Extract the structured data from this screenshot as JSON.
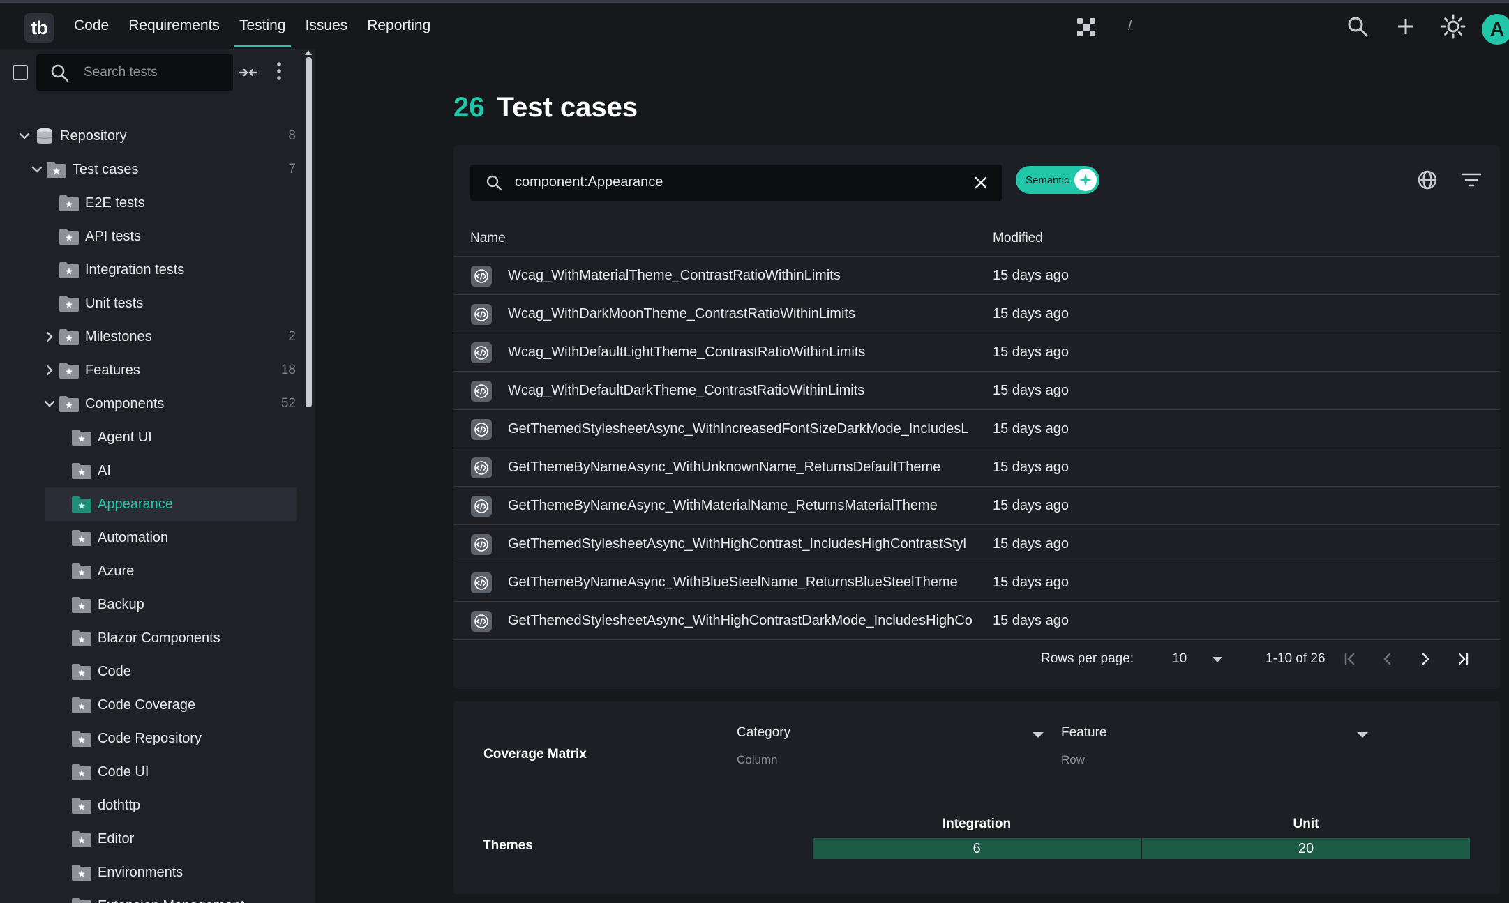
{
  "app": {
    "logo_text": "tb",
    "nav": [
      "Code",
      "Requirements",
      "Testing",
      "Issues",
      "Reporting"
    ],
    "active_nav": "Testing",
    "breadcrumb_separator": "/",
    "avatar_initial": "A",
    "accent_color": "#22c7a9"
  },
  "sidebar": {
    "search_placeholder": "Search tests",
    "tree": [
      {
        "label": "Repository",
        "count": "8",
        "chevron": "down",
        "icon": "database-icon",
        "level": 0
      },
      {
        "label": "Test cases",
        "count": "7",
        "chevron": "down",
        "icon": "folder-icon",
        "level": 1
      },
      {
        "label": "E2E tests",
        "count": "",
        "chevron": "",
        "icon": "folder-icon",
        "level": 2
      },
      {
        "label": "API tests",
        "count": "",
        "chevron": "",
        "icon": "folder-icon",
        "level": 2
      },
      {
        "label": "Integration tests",
        "count": "",
        "chevron": "",
        "icon": "folder-icon",
        "level": 2
      },
      {
        "label": "Unit tests",
        "count": "",
        "chevron": "",
        "icon": "folder-icon",
        "level": 2
      },
      {
        "label": "Milestones",
        "count": "2",
        "chevron": "right",
        "icon": "folder-icon",
        "level": 2
      },
      {
        "label": "Features",
        "count": "18",
        "chevron": "right",
        "icon": "folder-icon",
        "level": 2
      },
      {
        "label": "Components",
        "count": "52",
        "chevron": "down",
        "icon": "folder-icon",
        "level": 2
      },
      {
        "label": "Agent UI",
        "count": "",
        "chevron": "",
        "icon": "folder-icon",
        "level": 3
      },
      {
        "label": "AI",
        "count": "",
        "chevron": "",
        "icon": "folder-icon",
        "level": 3
      },
      {
        "label": "Appearance",
        "count": "",
        "chevron": "",
        "icon": "folder-icon",
        "level": 3,
        "selected": true
      },
      {
        "label": "Automation",
        "count": "",
        "chevron": "",
        "icon": "folder-icon",
        "level": 3
      },
      {
        "label": "Azure",
        "count": "",
        "chevron": "",
        "icon": "folder-icon",
        "level": 3
      },
      {
        "label": "Backup",
        "count": "",
        "chevron": "",
        "icon": "folder-icon",
        "level": 3
      },
      {
        "label": "Blazor Components",
        "count": "",
        "chevron": "",
        "icon": "folder-icon",
        "level": 3
      },
      {
        "label": "Code",
        "count": "",
        "chevron": "",
        "icon": "folder-icon",
        "level": 3
      },
      {
        "label": "Code Coverage",
        "count": "",
        "chevron": "",
        "icon": "folder-icon",
        "level": 3
      },
      {
        "label": "Code Repository",
        "count": "",
        "chevron": "",
        "icon": "folder-icon",
        "level": 3
      },
      {
        "label": "Code UI",
        "count": "",
        "chevron": "",
        "icon": "folder-icon",
        "level": 3
      },
      {
        "label": "dothttp",
        "count": "",
        "chevron": "",
        "icon": "folder-icon",
        "level": 3
      },
      {
        "label": "Editor",
        "count": "",
        "chevron": "",
        "icon": "folder-icon",
        "level": 3
      },
      {
        "label": "Environments",
        "count": "",
        "chevron": "",
        "icon": "folder-icon",
        "level": 3
      },
      {
        "label": "Extension Management",
        "count": "",
        "chevron": "",
        "icon": "folder-icon",
        "level": 3
      }
    ]
  },
  "main": {
    "count": "26",
    "title": "Test cases",
    "query": "component:Appearance",
    "semantic_label": "Semantic",
    "columns": {
      "name": "Name",
      "modified": "Modified"
    },
    "rows": [
      {
        "name": "Wcag_WithMaterialTheme_ContrastRatioWithinLimits",
        "modified": "15 days ago"
      },
      {
        "name": "Wcag_WithDarkMoonTheme_ContrastRatioWithinLimits",
        "modified": "15 days ago"
      },
      {
        "name": "Wcag_WithDefaultLightTheme_ContrastRatioWithinLimits",
        "modified": "15 days ago"
      },
      {
        "name": "Wcag_WithDefaultDarkTheme_ContrastRatioWithinLimits",
        "modified": "15 days ago"
      },
      {
        "name": "GetThemedStylesheetAsync_WithIncreasedFontSizeDarkMode_IncludesL",
        "modified": "15 days ago"
      },
      {
        "name": "GetThemeByNameAsync_WithUnknownName_ReturnsDefaultTheme",
        "modified": "15 days ago"
      },
      {
        "name": "GetThemeByNameAsync_WithMaterialName_ReturnsMaterialTheme",
        "modified": "15 days ago"
      },
      {
        "name": "GetThemedStylesheetAsync_WithHighContrast_IncludesHighContrastStyl",
        "modified": "15 days ago"
      },
      {
        "name": "GetThemeByNameAsync_WithBlueSteelName_ReturnsBlueSteelTheme",
        "modified": "15 days ago"
      },
      {
        "name": "GetThemedStylesheetAsync_WithHighContrastDarkMode_IncludesHighCo",
        "modified": "15 days ago"
      }
    ],
    "pager": {
      "rows_per_page_label": "Rows per page:",
      "rows_per_page": "10",
      "range": "1-10 of 26"
    }
  },
  "coverage": {
    "title": "Coverage Matrix",
    "column_select": {
      "value": "Category",
      "label": "Column"
    },
    "row_select": {
      "value": "Feature",
      "label": "Row"
    },
    "matrix": {
      "columns": [
        "Integration",
        "Unit"
      ],
      "rows": [
        {
          "label": "Themes",
          "values": [
            "6",
            "20"
          ]
        }
      ]
    }
  }
}
